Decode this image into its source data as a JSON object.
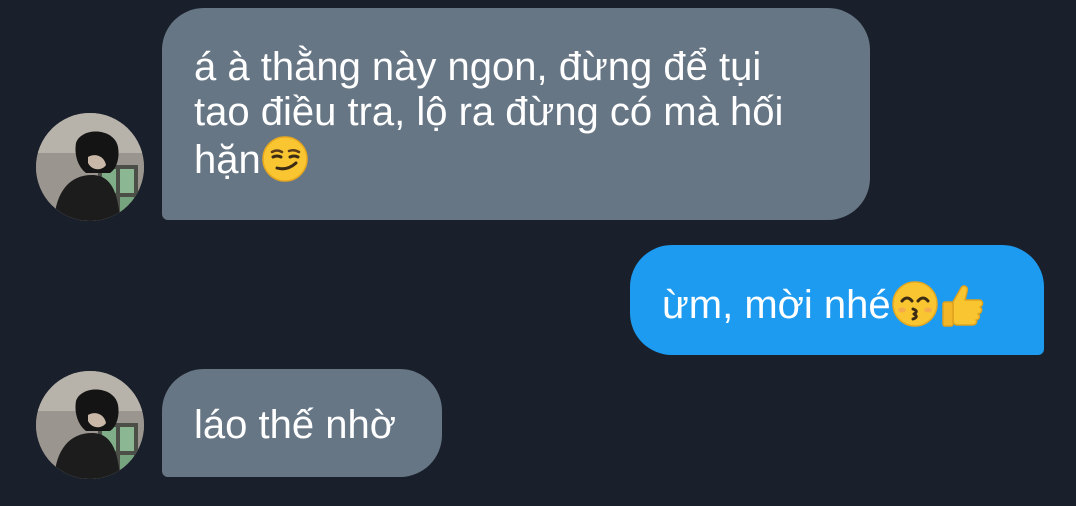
{
  "messages": [
    {
      "direction": "incoming",
      "text": "á à thằng này ngon, đừng để tụi\ntao điều tra, lộ ra đừng có mà hối\nhặn",
      "emojis": [
        "smirking-face"
      ]
    },
    {
      "direction": "outgoing",
      "text": "ừm, mời nhé",
      "emojis": [
        "kissing-face-smiling-eyes",
        "thumbs-up"
      ]
    },
    {
      "direction": "incoming",
      "text": "láo thế nhờ",
      "emojis": []
    }
  ],
  "colors": {
    "background": "#1a202b",
    "incoming_bubble": "#677685",
    "outgoing_bubble": "#1d9bf0",
    "text": "#ffffff"
  }
}
